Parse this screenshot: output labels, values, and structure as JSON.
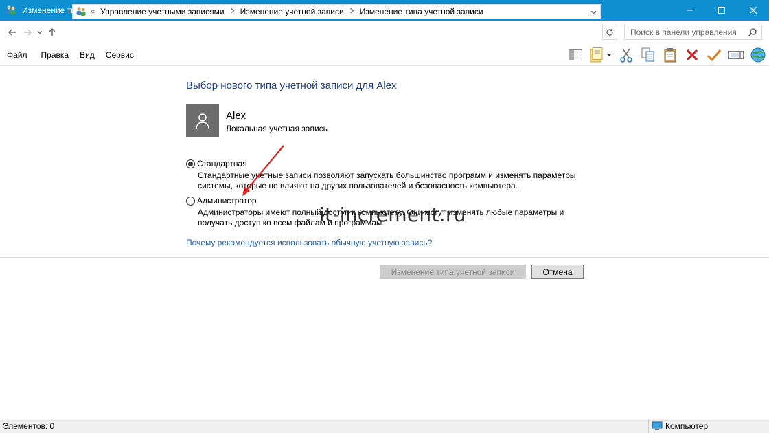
{
  "window": {
    "title": "Изменение типа учетной записи",
    "minimize_label": "—",
    "maximize_label": "☐",
    "close_label": "✕"
  },
  "address": {
    "root_marker": "«",
    "breadcrumbs": [
      "Управление учетными записями",
      "Изменение учетной записи",
      "Изменение типа учетной записи"
    ],
    "search_placeholder": "Поиск в панели управления"
  },
  "menu": {
    "items": [
      "Файл",
      "Правка",
      "Вид",
      "Сервис"
    ]
  },
  "content": {
    "heading": "Выбор нового типа учетной записи для Alex",
    "user": {
      "name": "Alex",
      "type": "Локальная учетная запись"
    },
    "options": [
      {
        "label": "Стандартная",
        "description_line1": "Стандартные учетные записи позволяют запускать большинство программ и изменять параметры",
        "description_line2": "системы, которые не влияют на других пользователей и безопасность компьютера.",
        "checked": true
      },
      {
        "label": "Администратор",
        "description_line1": "Администраторы имеют полный доступ к компьютеру. Они могут изменять любые параметры и",
        "description_line2": "получать доступ ко всем файлам и программам.",
        "checked": false
      }
    ],
    "help_link": "Почему рекомендуется использовать обычную учетную запись?",
    "buttons": {
      "change": "Изменение типа учетной записи",
      "cancel": "Отмена"
    },
    "watermark": "it-increment.ru"
  },
  "status": {
    "items_count": "Элементов: 0",
    "location": "Компьютер"
  },
  "colors": {
    "titlebar": "#0e8fd1",
    "heading": "#1e3f8b",
    "link": "#1e5fb3",
    "annotation_arrow": "#e02020"
  }
}
